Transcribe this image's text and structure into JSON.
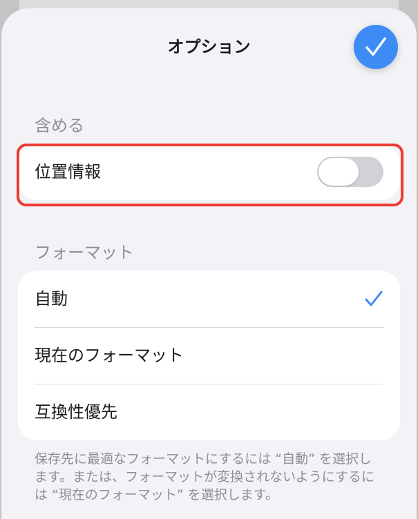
{
  "sheet": {
    "title": "オプション",
    "done_icon": "checkmark-icon",
    "accent_color": "#3d8bf5"
  },
  "include_section": {
    "header": "含める",
    "location_label": "位置情報",
    "location_enabled": false
  },
  "format_section": {
    "header": "フォーマット",
    "options": [
      {
        "label": "自動",
        "selected": true
      },
      {
        "label": "現在のフォーマット",
        "selected": false
      },
      {
        "label": "互換性優先",
        "selected": false
      }
    ],
    "footer": "保存先に最適なフォーマットにするには “自動” を選択します。または、フォーマットが変換されないようにするには “現在のフォーマット” を選択します。"
  },
  "annotation": {
    "highlight_color": "#ee3b30"
  }
}
